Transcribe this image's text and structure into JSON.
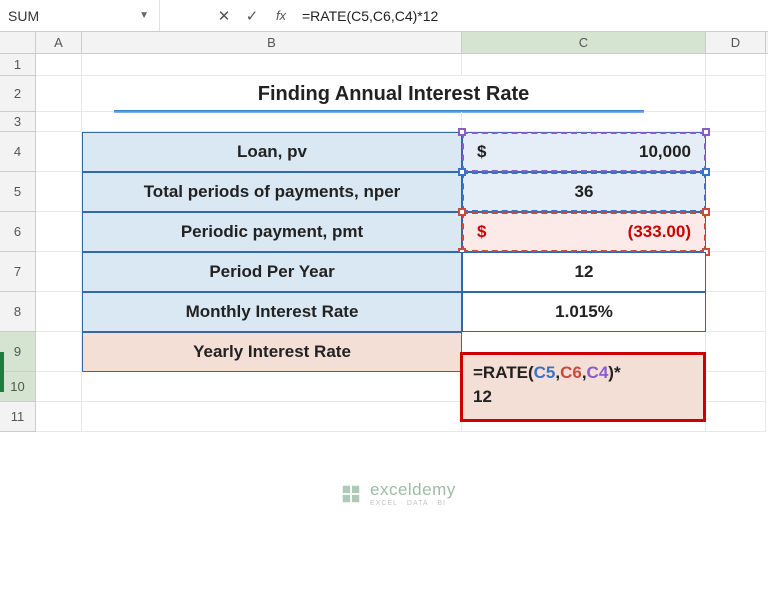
{
  "name_box": "SUM",
  "formula": "=RATE(C5,C6,C4)*12",
  "columns": [
    "A",
    "B",
    "C",
    "D"
  ],
  "rows": [
    "1",
    "2",
    "3",
    "4",
    "5",
    "6",
    "7",
    "8",
    "9",
    "10",
    "11"
  ],
  "title": "Finding Annual Interest Rate",
  "table": {
    "r4": {
      "label": "Loan, pv",
      "currency": "$",
      "value": "10,000"
    },
    "r5": {
      "label": "Total periods of payments, nper",
      "value": "36"
    },
    "r6": {
      "label": "Periodic payment, pmt",
      "currency": "$",
      "value": "(333.00)"
    },
    "r7": {
      "label": "Period Per Year",
      "value": "12"
    },
    "r8": {
      "label": "Monthly Interest Rate",
      "value": "1.015%"
    },
    "r9": {
      "label": "Yearly Interest Rate"
    }
  },
  "formula_cell": {
    "prefix": "=RATE(",
    "c5": "C5",
    "c6": "C6",
    "c4": "C4",
    "suffix": ")*",
    "line2": "12"
  },
  "watermark": {
    "brand": "exceldemy",
    "tag": "EXCEL · DATA · BI"
  },
  "chart_data": {
    "type": "table",
    "title": "Finding Annual Interest Rate",
    "rows": [
      {
        "label": "Loan, pv",
        "value": 10000,
        "display": "$ 10,000"
      },
      {
        "label": "Total periods of payments, nper",
        "value": 36,
        "display": "36"
      },
      {
        "label": "Periodic payment, pmt",
        "value": -333.0,
        "display": "$ (333.00)"
      },
      {
        "label": "Period Per Year",
        "value": 12,
        "display": "12"
      },
      {
        "label": "Monthly Interest Rate",
        "value": 0.01015,
        "display": "1.015%"
      },
      {
        "label": "Yearly Interest Rate",
        "formula": "=RATE(C5,C6,C4)*12"
      }
    ]
  }
}
